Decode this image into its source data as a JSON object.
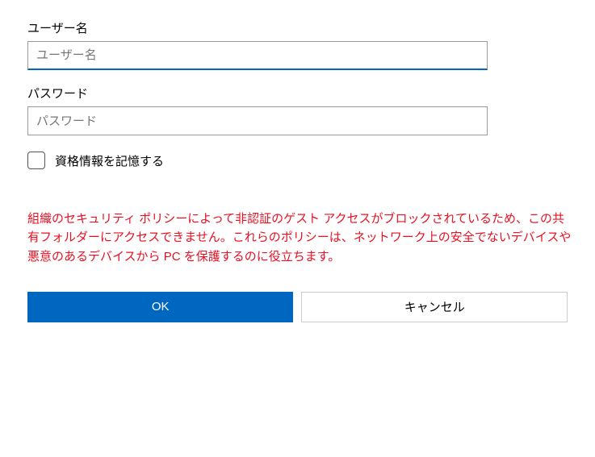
{
  "fields": {
    "username": {
      "label": "ユーザー名",
      "placeholder": "ユーザー名",
      "value": ""
    },
    "password": {
      "label": "パスワード",
      "placeholder": "パスワード",
      "value": ""
    }
  },
  "remember": {
    "label": "資格情報を記憶する",
    "checked": false
  },
  "error_message": "組織のセキュリティ ポリシーによって非認証のゲスト アクセスがブロックされているため、この共有フォルダーにアクセスできません。これらのポリシーは、ネットワーク上の安全でないデバイスや悪意のあるデバイスから PC を保護するのに役立ちます。",
  "buttons": {
    "ok": "OK",
    "cancel": "キャンセル"
  }
}
